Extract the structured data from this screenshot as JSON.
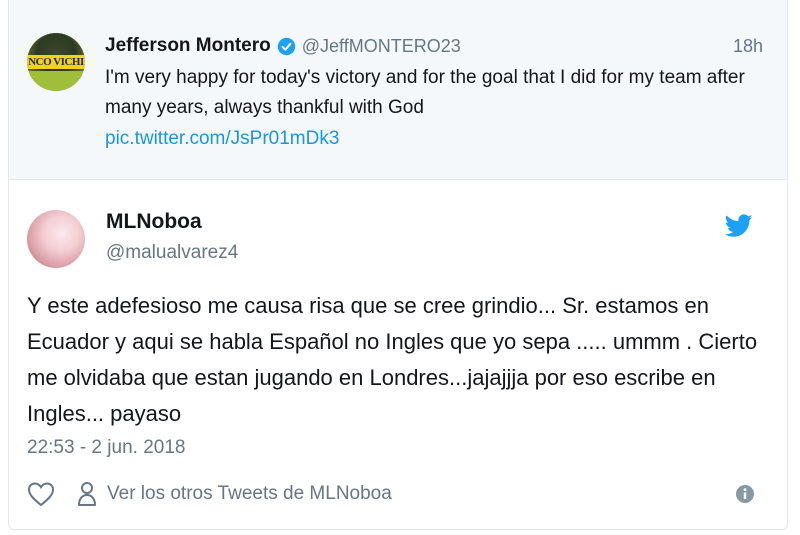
{
  "parent_tweet": {
    "avatar_text": "NCO VICHI",
    "name": "Jefferson Montero",
    "verified_icon": "verified-badge-icon",
    "handle": "@JeffMONTERO23",
    "time": "18h",
    "text": "I'm very happy for today's victory and for the goal that I did for my team after many years, always thankful with God",
    "link": "pic.twitter.com/JsPr01mDk3"
  },
  "main_tweet": {
    "name": "MLNoboa",
    "handle": "@malualvarez4",
    "brand_icon": "twitter-bird-icon",
    "text": "Y este adefesioso me causa risa que se cree grindio... Sr. estamos en Ecuador y aqui se habla Español no Ingles que yo sepa ..... ummm . Cierto me olvidaba que estan jugando en Londres...jajajjja por eso escribe en Ingles... payaso",
    "date": "22:53 - 2 jun. 2018"
  },
  "actions": {
    "like_icon": "heart-icon",
    "profile_icon": "person-icon",
    "see_more_label": "Ver los otros Tweets de MLNoboa",
    "info_icon": "info-icon"
  },
  "colors": {
    "link": "#1b95e0",
    "muted": "#657786",
    "text": "#14171a",
    "parent_bg": "#f5f8fa"
  }
}
